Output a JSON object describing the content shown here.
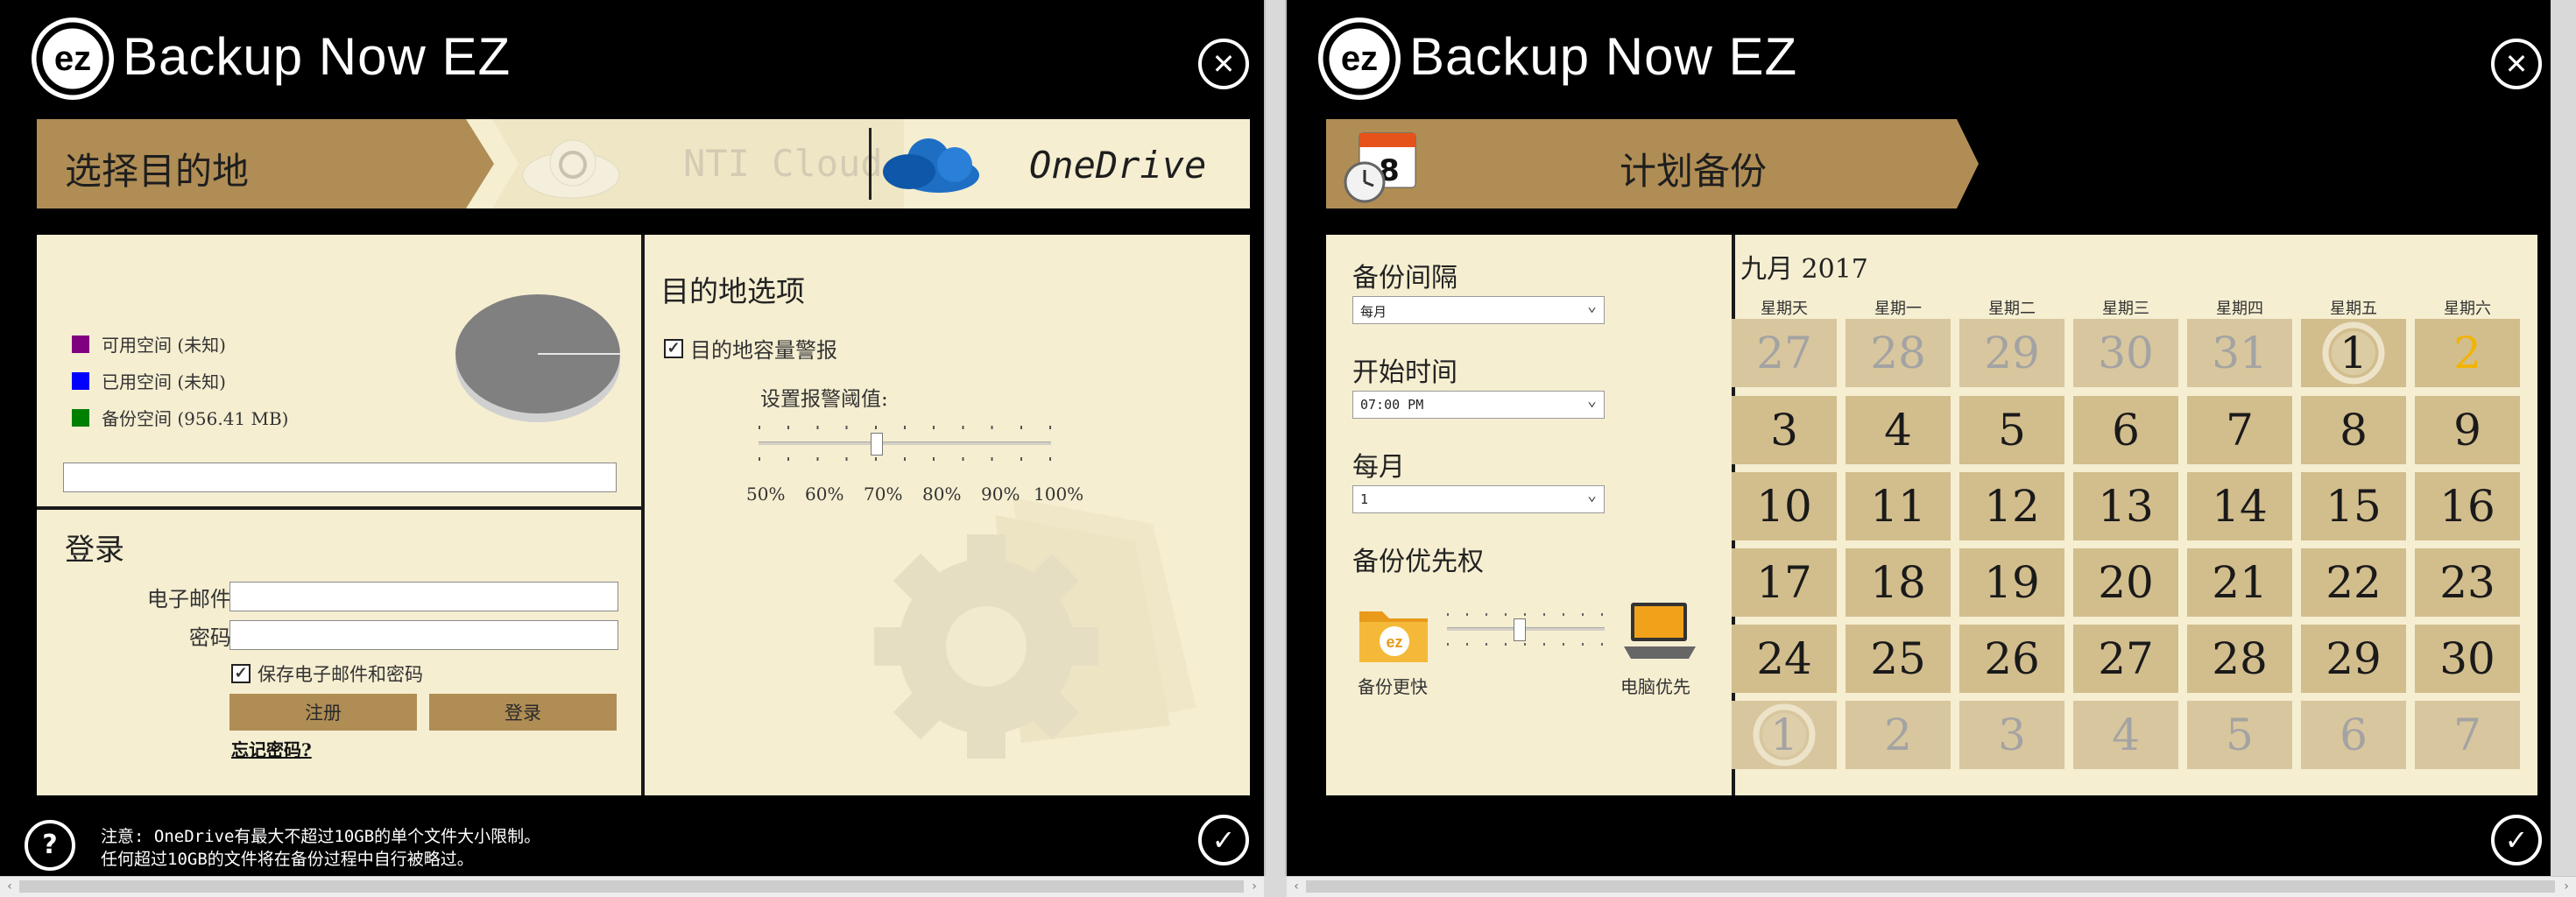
{
  "app_title": "Backup Now EZ",
  "left": {
    "header": {
      "step_label": "选择目的地",
      "options": [
        {
          "label": "NTI Cloud",
          "state": "disabled"
        },
        {
          "label": "OneDrive",
          "state": "selected"
        }
      ]
    },
    "storage": {
      "legend": [
        {
          "label": "可用空间 (未知)",
          "color": "#800080"
        },
        {
          "label": "已用空间 (未知)",
          "color": "#0000ff"
        },
        {
          "label": "备份空间 (956.41 MB)",
          "color": "#008000"
        }
      ]
    },
    "login": {
      "title": "登录",
      "email_label": "电子邮件:",
      "password_label": "密码:",
      "remember_label": "保存电子邮件和密码",
      "register_button": "注册",
      "login_button": "登录",
      "forgot_link": "忘记密码?"
    },
    "destination_options": {
      "title": "目的地选项",
      "capacity_warning_label": "目的地容量警报",
      "threshold_label": "设置报警阈值:",
      "scale": [
        "50%",
        "60%",
        "70%",
        "80%",
        "90%",
        "100%"
      ],
      "threshold_value": "70%"
    },
    "footer_note": [
      "注意: OneDrive有最大不超过10GB的单个文件大小限制。",
      "任何超过10GB的文件将在备份过程中自行被略过。"
    ]
  },
  "right": {
    "header": {
      "step_label": "计划备份"
    },
    "interval_label": "备份间隔",
    "interval_value": "每月",
    "start_time_label": "开始时间",
    "start_time_value": "07:00 PM",
    "monthly_label": "每月",
    "monthly_value": "1",
    "priority_label": "备份优先权",
    "priority_left": "备份更快",
    "priority_right": "电脑优先",
    "calendar": {
      "month_title": "九月 2017",
      "weekdays": [
        "星期天",
        "星期一",
        "星期二",
        "星期三",
        "星期四",
        "星期五",
        "星期六"
      ],
      "weeks": [
        [
          "27",
          "28",
          "29",
          "30",
          "31",
          "1",
          "2"
        ],
        [
          "3",
          "4",
          "5",
          "6",
          "7",
          "8",
          "9"
        ],
        [
          "10",
          "11",
          "12",
          "13",
          "14",
          "15",
          "16"
        ],
        [
          "17",
          "18",
          "19",
          "20",
          "21",
          "22",
          "23"
        ],
        [
          "24",
          "25",
          "26",
          "27",
          "28",
          "29",
          "30"
        ],
        [
          "1",
          "2",
          "3",
          "4",
          "5",
          "6",
          "7"
        ]
      ]
    }
  },
  "colors": {
    "cream": "#f5eed1",
    "tan": "#b08d55",
    "calendar_cell": "#d2bd8d",
    "highlight": "#f2b400"
  }
}
